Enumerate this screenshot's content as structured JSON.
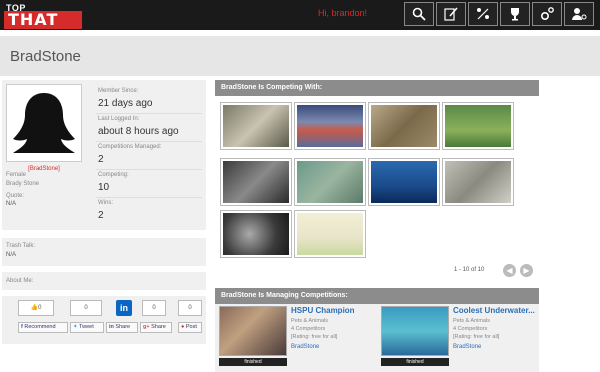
{
  "header": {
    "logo_top": "TOP",
    "logo_that": "THAT",
    "greeting": "Hi, brandon!",
    "nav_icons": [
      "search-icon",
      "edit-icon",
      "compete-icon",
      "trophy-icon",
      "settings-icon",
      "user-icon"
    ]
  },
  "profile": {
    "name": "BradStone",
    "username_link": "[BradStone]",
    "gender": "Female",
    "full_name": "Brady Stone",
    "quote_label": "Quote:",
    "quote_value": "N/A",
    "stats": [
      {
        "label": "Member Since:",
        "value": "21 days ago"
      },
      {
        "label": "Last Logged In:",
        "value": "about 8 hours ago"
      },
      {
        "label": "Competitions Managed:",
        "value": "2"
      },
      {
        "label": "Competing:",
        "value": "10"
      },
      {
        "label": "Wins:",
        "value": "2"
      }
    ],
    "trash_talk_label": "Trash Talk:",
    "trash_talk_value": "N/A",
    "about_label": "About Me:"
  },
  "social": {
    "like_count": "0",
    "box2": "0",
    "box3": "0",
    "box4": "0",
    "recommend": "Recommend",
    "tweet": "Tweet",
    "share_in": "Share",
    "share": "Share",
    "post": "Post"
  },
  "competing": {
    "heading": "BradStone Is Competing With:",
    "pager_text": "1 - 10 of 10",
    "thumb_count": 10
  },
  "managing": {
    "heading": "BradStone Is Managing Competitions:",
    "cards": [
      {
        "title": "HSPU Champion",
        "category": "Pets & Animals",
        "competitors": "4 Competitors",
        "rating": "[Rating: free for all]",
        "owner": "BradStone",
        "status": "finished"
      },
      {
        "title": "Coolest Underwater...",
        "category": "Pets & Animals",
        "competitors": "4 Competitors",
        "rating": "[Rating: free for all]",
        "owner": "BradStone",
        "status": "finished"
      }
    ]
  },
  "colors": {
    "brand_red": "#d52b2b",
    "link_blue": "#2a6fb5",
    "section_gray": "#8c8c8c"
  }
}
